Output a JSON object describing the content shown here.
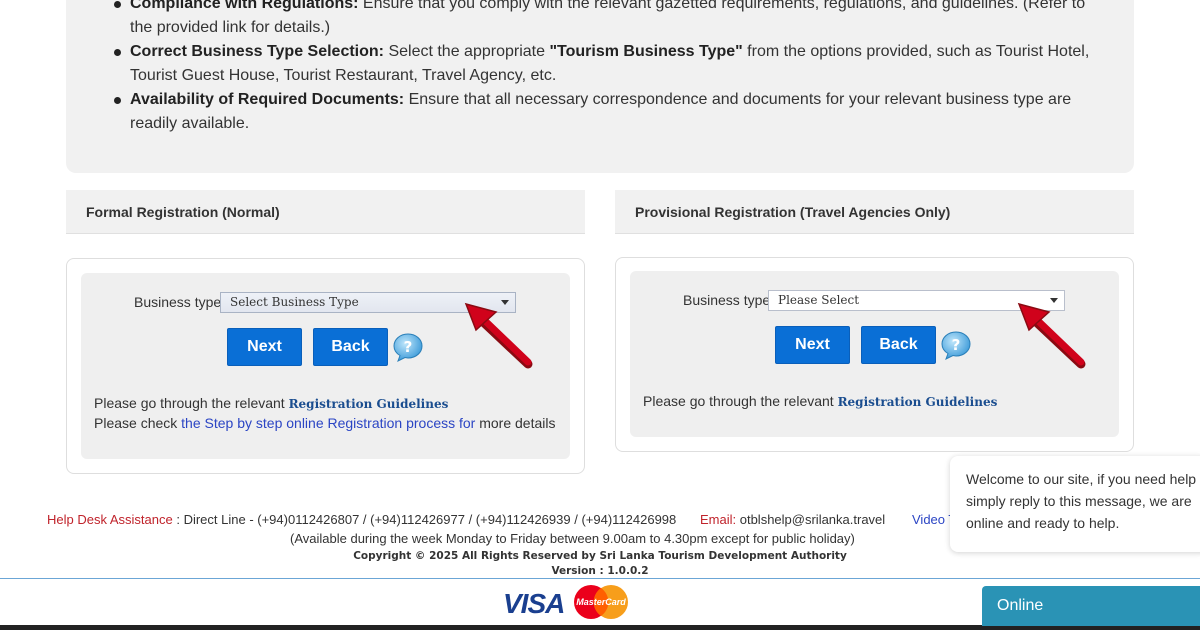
{
  "info_items": [
    {
      "bold": "Compliance with Regulations:",
      "text": " Ensure that you comply with the relevant gazetted requirements, regulations, and guidelines. (Refer to the provided link for details.)"
    },
    {
      "bold": "Correct Business Type Selection:",
      "text": " Select the appropriate ",
      "bold2": "\"Tourism Business Type\"",
      "text2": " from the options provided, such as Tourist Hotel, Tourist Guest House, Tourist Restaurant, Travel Agency, etc."
    },
    {
      "bold": "Availability of Required Documents:",
      "text": " Ensure that all necessary correspondence and documents for your relevant business type are readily available."
    }
  ],
  "formal": {
    "header": "Formal Registration (Normal)",
    "field_label": "Business type",
    "select_value": "Select Business Type",
    "next_label": "Next",
    "back_label": "Back",
    "note1_prefix": "Please go through the relevant ",
    "note1_link": "Registration Guidelines",
    "note2_prefix": "Please check ",
    "note2_link": "the Step by step online Registration process for",
    "note2_suffix": " more details"
  },
  "provisional": {
    "header": "Provisional Registration (Travel Agencies Only)",
    "field_label": "Business type",
    "select_value": "Please Select",
    "next_label": "Next",
    "back_label": "Back",
    "note1_prefix": "Please go through the relevant ",
    "note1_link": "Registration Guidelines"
  },
  "footer": {
    "helpdesk_label": "Help Desk Assistance",
    "helpdesk_text": " : Direct Line - (+94)0112426807 / (+94)112426977 / (+94)112426939 / (+94)112426998",
    "email_label": "Email:",
    "email_value": " otblshelp@srilanka.travel",
    "video_link": "Video T",
    "availability": "(Available during the week Monday to Friday between 9.00am to 4.30pm except for public holiday)",
    "copyright": "Copyright © 2025 All Rights Reserved by Sri Lanka Tourism Development Authority",
    "version": "Version :  1.0.0.2",
    "visa_label": "VISA",
    "mastercard_label": "MasterCard"
  },
  "chat": {
    "message": "Welcome to our site, if you need help simply reply to this message, we are online and ready to help.",
    "status": "Online"
  },
  "colors": {
    "button_blue": "#0a6fd6",
    "helpdesk_red": "#c0232b",
    "link_blue": "#2b45c4",
    "chat_teal": "#2a93b5",
    "arrow_red": "#d0021b"
  },
  "icons": [
    "help-icon",
    "red-arrow-icon",
    "visa-logo",
    "mastercard-logo"
  ]
}
